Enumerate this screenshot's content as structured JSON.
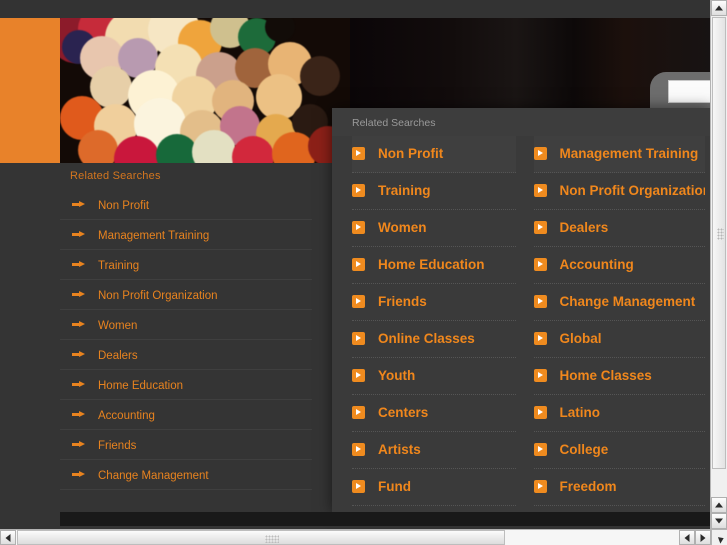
{
  "banner": {
    "accent_color": "#e8822a",
    "background_color": "#0a0608"
  },
  "search": {
    "value": "",
    "placeholder": "",
    "icon": "search-icon"
  },
  "sidebar": {
    "title": "Related Searches",
    "items": [
      {
        "label": "Non Profit",
        "icon": "arrow-right-icon"
      },
      {
        "label": "Management Training",
        "icon": "arrow-right-icon"
      },
      {
        "label": "Training",
        "icon": "arrow-right-icon"
      },
      {
        "label": "Non Profit Organization",
        "icon": "arrow-right-icon"
      },
      {
        "label": "Women",
        "icon": "arrow-right-icon"
      },
      {
        "label": "Dealers",
        "icon": "arrow-right-icon"
      },
      {
        "label": "Home Education",
        "icon": "arrow-right-icon"
      },
      {
        "label": "Accounting",
        "icon": "arrow-right-icon"
      },
      {
        "label": "Friends",
        "icon": "arrow-right-icon"
      },
      {
        "label": "Change Management",
        "icon": "arrow-right-icon"
      }
    ]
  },
  "overlay": {
    "title": "Related Searches",
    "accent_color": "#f0871c",
    "left_items": [
      {
        "label": "Non Profit",
        "icon": "chevron-right-badge-icon"
      },
      {
        "label": "Training",
        "icon": "chevron-right-badge-icon"
      },
      {
        "label": "Women",
        "icon": "chevron-right-badge-icon"
      },
      {
        "label": "Home Education",
        "icon": "chevron-right-badge-icon"
      },
      {
        "label": "Friends",
        "icon": "chevron-right-badge-icon"
      },
      {
        "label": "Online Classes",
        "icon": "chevron-right-badge-icon"
      },
      {
        "label": "Youth",
        "icon": "chevron-right-badge-icon"
      },
      {
        "label": "Centers",
        "icon": "chevron-right-badge-icon"
      },
      {
        "label": "Artists",
        "icon": "chevron-right-badge-icon"
      },
      {
        "label": "Fund",
        "icon": "chevron-right-badge-icon"
      }
    ],
    "right_items": [
      {
        "label": "Management Training",
        "icon": "chevron-right-badge-icon"
      },
      {
        "label": "Non Profit Organization",
        "icon": "chevron-right-badge-icon"
      },
      {
        "label": "Dealers",
        "icon": "chevron-right-badge-icon"
      },
      {
        "label": "Accounting",
        "icon": "chevron-right-badge-icon"
      },
      {
        "label": "Change Management",
        "icon": "chevron-right-badge-icon"
      },
      {
        "label": "Global",
        "icon": "chevron-right-badge-icon"
      },
      {
        "label": "Home Classes",
        "icon": "chevron-right-badge-icon"
      },
      {
        "label": "Latino",
        "icon": "chevron-right-badge-icon"
      },
      {
        "label": "College",
        "icon": "chevron-right-badge-icon"
      },
      {
        "label": "Freedom",
        "icon": "chevron-right-badge-icon"
      }
    ]
  },
  "scrollbars": {
    "vertical": {
      "up_icon": "caret-up-icon",
      "down_icon": "caret-down-icon",
      "grip": "grip-dots"
    },
    "horizontal": {
      "left_icon": "caret-left-icon",
      "right_icon": "caret-right-icon",
      "grip": "grip-dots"
    }
  }
}
